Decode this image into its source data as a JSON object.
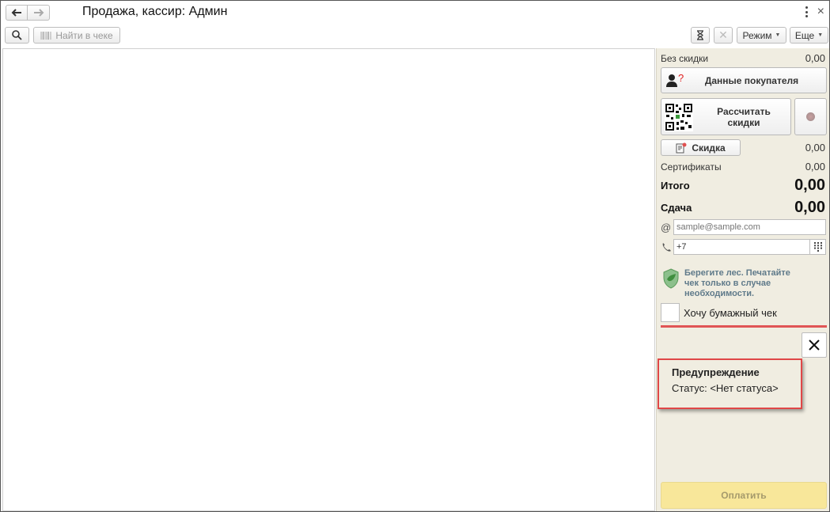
{
  "window": {
    "title": "Продажа, кассир: Админ"
  },
  "toolbar": {
    "find_label": "Найти в чеке",
    "mode_label": "Режим",
    "more_label": "Еще"
  },
  "panel": {
    "no_discount_label": "Без скидки",
    "no_discount_value": "0,00",
    "customer_button": "Данные покупателя",
    "calc_button_line1": "Рассчитать",
    "calc_button_line2": "скидки",
    "discount_button": "Скидка",
    "discount_value": "0,00",
    "certificates_label": "Сертификаты",
    "certificates_value": "0,00",
    "total_label": "Итого",
    "total_value": "0,00",
    "change_label": "Сдача",
    "change_value": "0,00",
    "email_placeholder": "sample@sample.com",
    "phone_value": "+7",
    "eco_line1": "Берегите лес. Печатайте",
    "eco_line2": "чек только в случае",
    "eco_line3": "необходимости.",
    "paper_check_label": "Хочу бумажный чек",
    "warning_title": "Предупреждение",
    "warning_status": "Статус: <Нет статуса>",
    "pay_button": "Оплатить"
  },
  "colors": {
    "panel_bg": "#f0ede1",
    "warning_border": "#e04747",
    "pay_button_bg": "#f8e79a",
    "eco_text": "#5f7a8a"
  },
  "icons": {
    "back": "arrow-left-icon",
    "forward": "arrow-right-icon",
    "search": "magnifier-icon",
    "barcode": "barcode-icon",
    "hourglass": "hourglass-icon",
    "user": "user-question-icon",
    "qr": "qr-code-icon",
    "discount": "discount-card-icon",
    "email": "at-sign-icon",
    "phone": "phone-icon",
    "keypad": "keypad-icon",
    "eco": "shield-leaf-icon",
    "close": "close-icon"
  }
}
